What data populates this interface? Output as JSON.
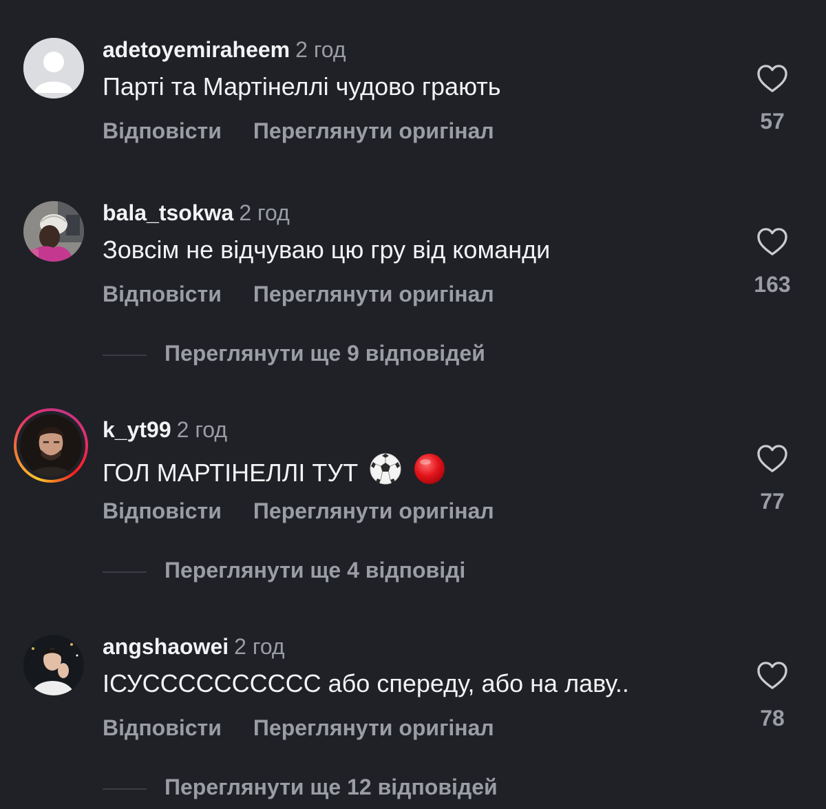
{
  "actions": {
    "reply_label": "Відповісти",
    "view_original_label": "Переглянути оригінал"
  },
  "comments": [
    {
      "username": "adetoyemiraheem",
      "time": "2 год",
      "text": "Парті та Мартінеллі чудово грають",
      "likes": "57",
      "avatar": "default-avatar-icon"
    },
    {
      "username": "bala_tsokwa",
      "time": "2 год",
      "text": "Зовсім не відчуваю цю гру від команди",
      "likes": "163",
      "avatar": "user-photo",
      "replies_label": "Переглянути ще 9 відповідей"
    },
    {
      "username": "k_yt99",
      "time": "2 год",
      "text": "ГОЛ МАРТІНЕЛЛІ ТУТ",
      "emoji": [
        "soccer-ball-icon",
        "red-circle-icon"
      ],
      "likes": "77",
      "avatar": "user-photo-story-ring",
      "replies_label": "Переглянути ще 4 відповіді"
    },
    {
      "username": "angshaowei",
      "time": "2 год",
      "text": "ІСУСССССССССС або спереду, або на лаву..",
      "likes": "78",
      "avatar": "user-photo",
      "replies_label": "Переглянути ще 12 відповідей"
    }
  ],
  "colors": {
    "background": "#1f2126",
    "primary_text": "#f2f3f5",
    "secondary_text": "#9a9da3"
  }
}
